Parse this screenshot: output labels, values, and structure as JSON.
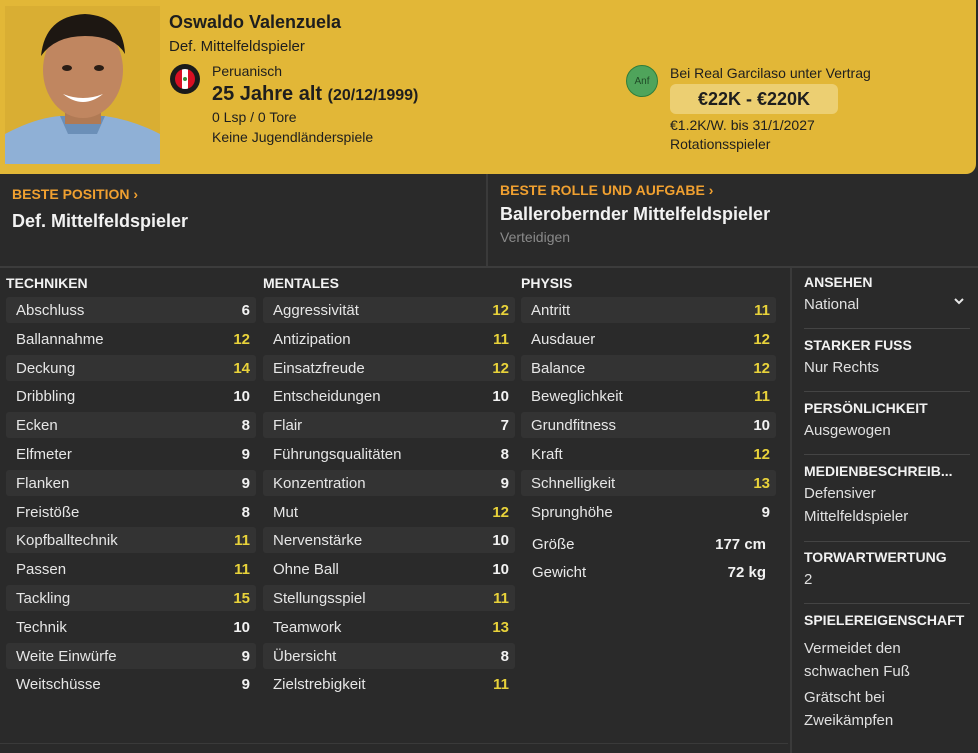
{
  "player": {
    "name": "Oswaldo Valenzuela",
    "position": "Def. Mittelfeldspieler",
    "nationality": "Peruanisch",
    "age": "25 Jahre alt",
    "dob": "(20/12/1999)",
    "apps_goals": "0 Lsp / 0 Tore",
    "youth_caps": "Keine Jugendländerspiele"
  },
  "contract": {
    "badge": "Anf",
    "club_text": "Bei Real Garcilaso unter Vertrag",
    "value_range": "€22K - €220K",
    "wage": "€1.2K/W. bis 31/1/2027",
    "status": "Rotationsspieler"
  },
  "best_position": {
    "title": "BESTE POSITION",
    "value": "Def. Mittelfeldspieler"
  },
  "best_role": {
    "title": "BESTE ROLLE UND AUFGABE",
    "value": "Ballerobernder Mittelfeldspieler",
    "duty": "Verteidigen"
  },
  "technical": {
    "title": "TECHNIKEN",
    "items": [
      {
        "label": "Abschluss",
        "value": "6",
        "hi": false
      },
      {
        "label": "Ballannahme",
        "value": "12",
        "hi": true
      },
      {
        "label": "Deckung",
        "value": "14",
        "hi": true
      },
      {
        "label": "Dribbling",
        "value": "10",
        "hi": false
      },
      {
        "label": "Ecken",
        "value": "8",
        "hi": false
      },
      {
        "label": "Elfmeter",
        "value": "9",
        "hi": false
      },
      {
        "label": "Flanken",
        "value": "9",
        "hi": false
      },
      {
        "label": "Freistöße",
        "value": "8",
        "hi": false
      },
      {
        "label": "Kopfballtechnik",
        "value": "11",
        "hi": true
      },
      {
        "label": "Passen",
        "value": "11",
        "hi": true
      },
      {
        "label": "Tackling",
        "value": "15",
        "hi": true
      },
      {
        "label": "Technik",
        "value": "10",
        "hi": false
      },
      {
        "label": "Weite Einwürfe",
        "value": "9",
        "hi": false
      },
      {
        "label": "Weitschüsse",
        "value": "9",
        "hi": false
      }
    ]
  },
  "mental": {
    "title": "MENTALES",
    "items": [
      {
        "label": "Aggressivität",
        "value": "12",
        "hi": true
      },
      {
        "label": "Antizipation",
        "value": "11",
        "hi": true
      },
      {
        "label": "Einsatzfreude",
        "value": "12",
        "hi": true
      },
      {
        "label": "Entscheidungen",
        "value": "10",
        "hi": false
      },
      {
        "label": "Flair",
        "value": "7",
        "hi": false
      },
      {
        "label": "Führungsqualitäten",
        "value": "8",
        "hi": false
      },
      {
        "label": "Konzentration",
        "value": "9",
        "hi": false
      },
      {
        "label": "Mut",
        "value": "12",
        "hi": true
      },
      {
        "label": "Nervenstärke",
        "value": "10",
        "hi": false
      },
      {
        "label": "Ohne Ball",
        "value": "10",
        "hi": false
      },
      {
        "label": "Stellungsspiel",
        "value": "11",
        "hi": true
      },
      {
        "label": "Teamwork",
        "value": "13",
        "hi": true
      },
      {
        "label": "Übersicht",
        "value": "8",
        "hi": false
      },
      {
        "label": "Zielstrebigkeit",
        "value": "11",
        "hi": true
      }
    ]
  },
  "physical": {
    "title": "PHYSIS",
    "items": [
      {
        "label": "Antritt",
        "value": "11",
        "hi": true
      },
      {
        "label": "Ausdauer",
        "value": "12",
        "hi": true
      },
      {
        "label": "Balance",
        "value": "12",
        "hi": true
      },
      {
        "label": "Beweglichkeit",
        "value": "11",
        "hi": true
      },
      {
        "label": "Grundfitness",
        "value": "10",
        "hi": false
      },
      {
        "label": "Kraft",
        "value": "12",
        "hi": true
      },
      {
        "label": "Schnelligkeit",
        "value": "13",
        "hi": true
      },
      {
        "label": "Sprunghöhe",
        "value": "9",
        "hi": false
      }
    ],
    "height_label": "Größe",
    "height_value": "177 cm",
    "weight_label": "Gewicht",
    "weight_value": "72 kg"
  },
  "side": {
    "reputation_title": "ANSEHEN",
    "reputation_value": "National",
    "foot_title": "STARKER FUSS",
    "foot_value": "Nur Rechts",
    "personality_title": "PERSÖNLICHKEIT",
    "personality_value": "Ausgewogen",
    "media_title": "MEDIENBESCHREIB...",
    "media_value_1": "Defensiver",
    "media_value_2": "Mittelfeldspieler",
    "gk_title": "TORWARTWERTUNG",
    "gk_value": "2",
    "traits_title": "SPIELEREIGENSCHAFT",
    "trait_1a": "Vermeidet den",
    "trait_1b": "schwachen Fuß",
    "trait_2a": "Grätscht bei",
    "trait_2b": "Zweikämpfen"
  },
  "colors": {
    "header_bg": "#e2b737",
    "accent_orange": "#f0a030",
    "highlight_yellow": "#e8d23a",
    "panel_bg": "#2a2a2a"
  }
}
